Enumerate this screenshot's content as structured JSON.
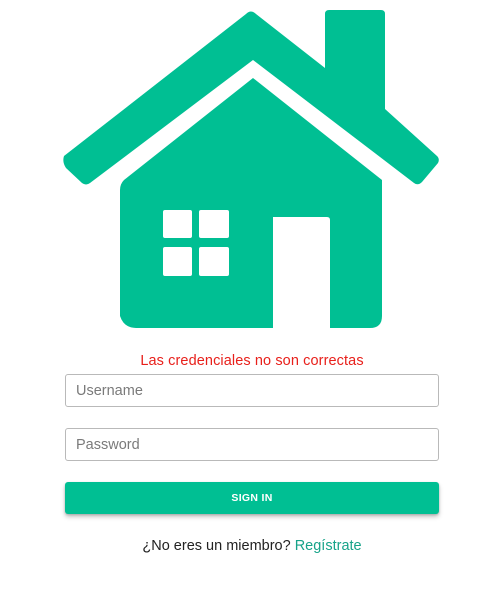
{
  "logo": {
    "icon": "house-icon",
    "color": "#00bf93"
  },
  "error_message": "Las credenciales no son correctas",
  "form": {
    "username_placeholder": "Username",
    "username_value": "",
    "password_placeholder": "Password",
    "password_value": "",
    "signin_label": "SIGN IN"
  },
  "register": {
    "prompt": "¿No eres un miembro?",
    "link_label": "Regístrate"
  },
  "colors": {
    "accent": "#00bf93",
    "error": "#e8201b",
    "link": "#17a389"
  }
}
